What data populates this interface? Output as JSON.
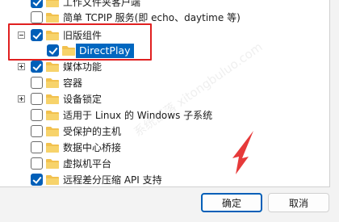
{
  "tree": {
    "items": [
      {
        "label": "工作文件夹客户端",
        "checked": true,
        "expander": "",
        "indent": 0
      },
      {
        "label": "简单 TCPIP 服务(即 echo、daytime 等)",
        "checked": false,
        "expander": "",
        "indent": 0
      },
      {
        "label": "旧版组件",
        "checked": true,
        "expander": "minus",
        "indent": 0
      },
      {
        "label": "DirectPlay",
        "checked": true,
        "expander": "",
        "indent": 1,
        "selected": true
      },
      {
        "label": "媒体功能",
        "checked": true,
        "expander": "plus",
        "indent": 0
      },
      {
        "label": "容器",
        "checked": false,
        "expander": "",
        "indent": 0
      },
      {
        "label": "设备锁定",
        "checked": false,
        "expander": "plus",
        "indent": 0
      },
      {
        "label": "适用于 Linux 的 Windows 子系统",
        "checked": false,
        "expander": "",
        "indent": 0
      },
      {
        "label": "受保护的主机",
        "checked": false,
        "expander": "",
        "indent": 0
      },
      {
        "label": "数据中心桥接",
        "checked": false,
        "expander": "",
        "indent": 0
      },
      {
        "label": "虚拟机平台",
        "checked": false,
        "expander": "",
        "indent": 0
      },
      {
        "label": "远程差分压缩 API 支持",
        "checked": true,
        "expander": "",
        "indent": 0
      }
    ]
  },
  "buttons": {
    "ok_label": "确定",
    "cancel_label": "取消"
  },
  "colors": {
    "accent": "#005fb8",
    "highlight_box": "#e02020",
    "folder": "#f2c14e"
  },
  "watermark_text": "系统部落 xitongbuluo.com"
}
